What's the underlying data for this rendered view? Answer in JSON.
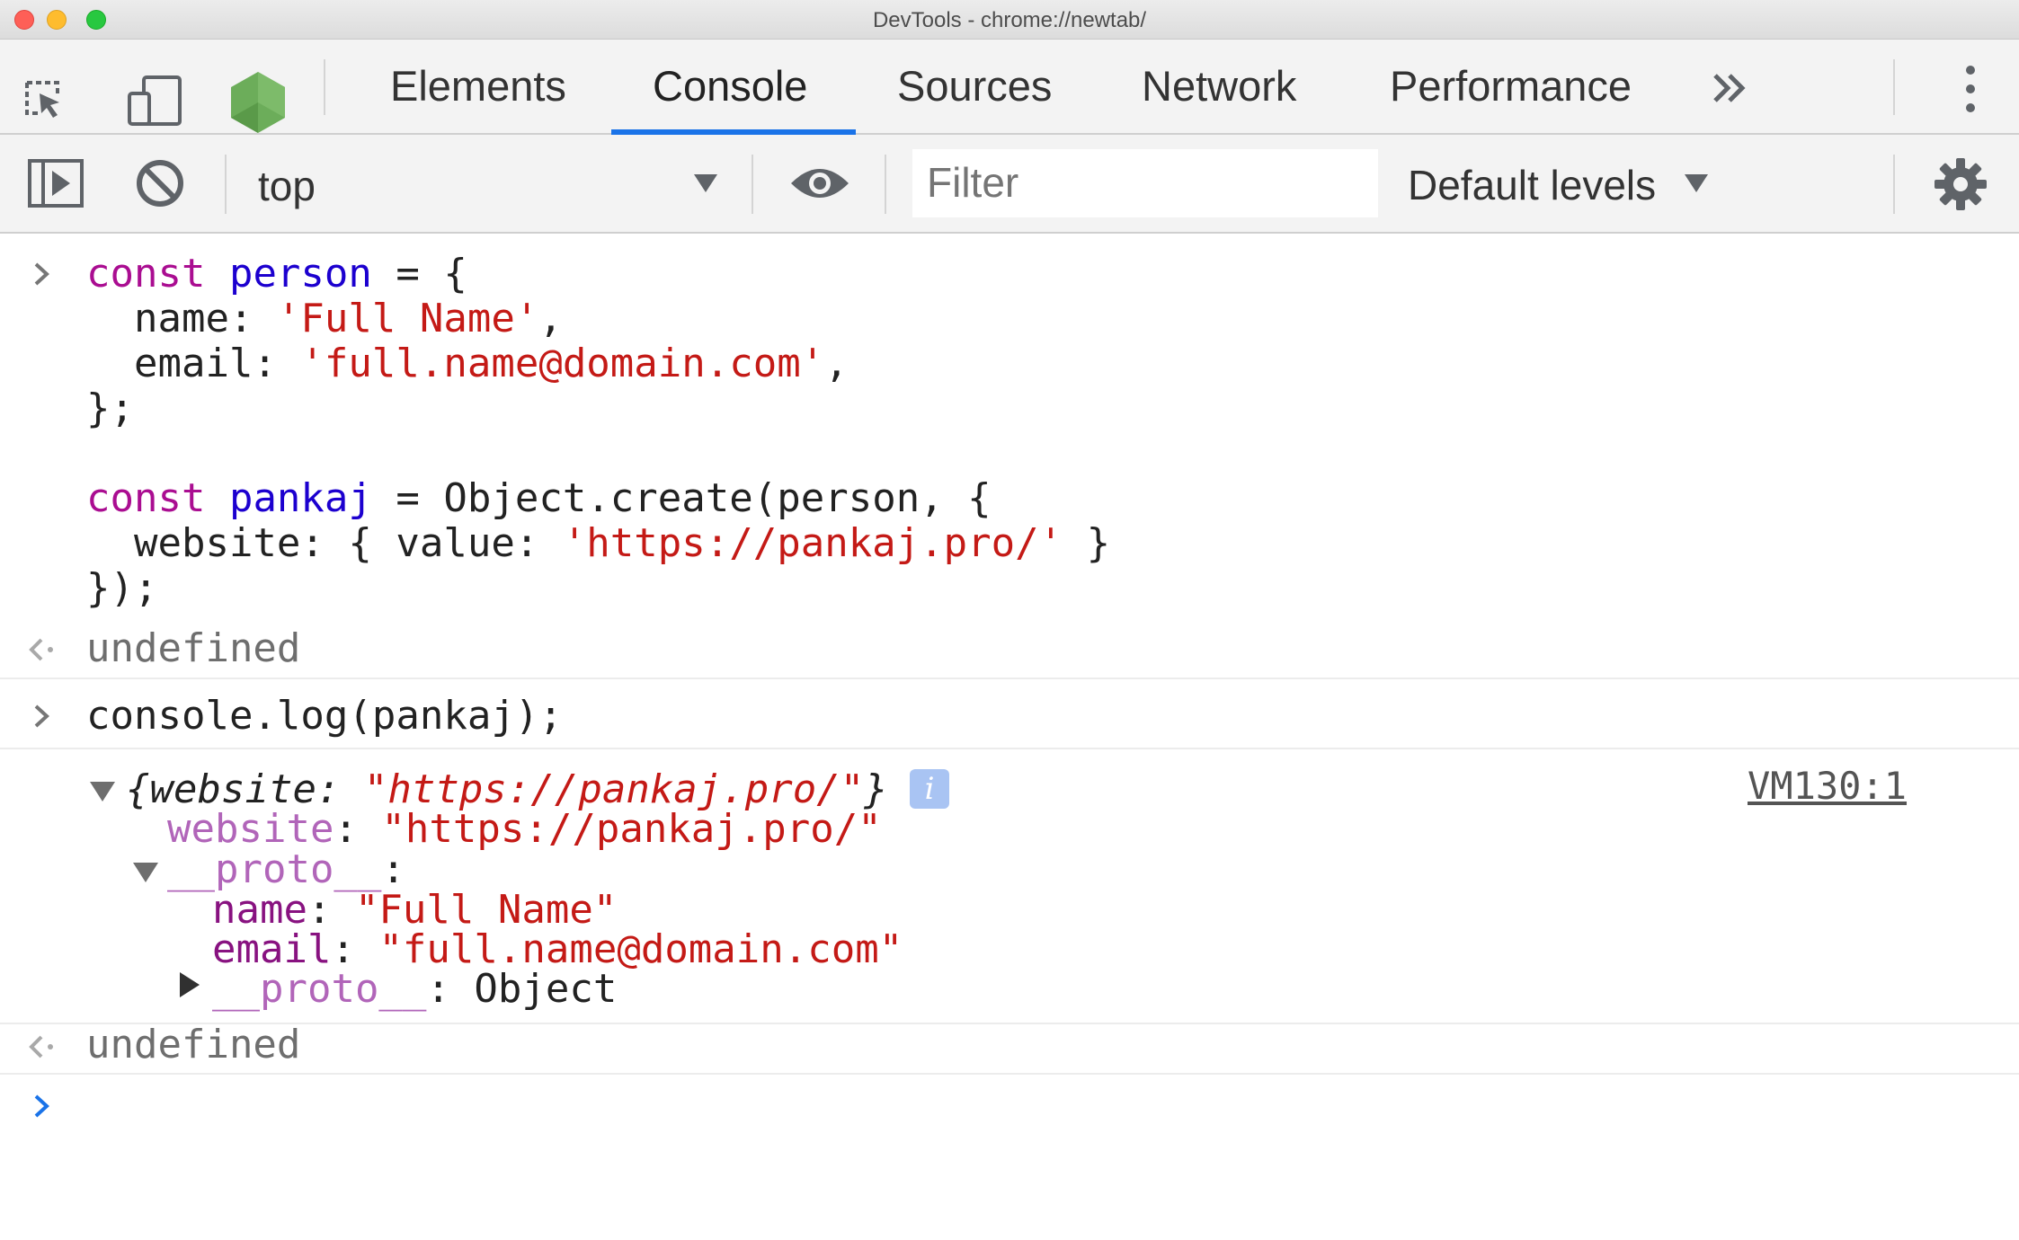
{
  "window": {
    "title": "DevTools - chrome://newtab/"
  },
  "tabs": [
    {
      "label": "Elements",
      "active": false
    },
    {
      "label": "Console",
      "active": true
    },
    {
      "label": "Sources",
      "active": false
    },
    {
      "label": "Network",
      "active": false
    },
    {
      "label": "Performance",
      "active": false
    }
  ],
  "toolbar": {
    "context": "top",
    "filter_placeholder": "Filter",
    "levels_label": "Default levels"
  },
  "console": {
    "input1": {
      "l1_kw": "const",
      "l1_var": "person",
      "l1_rest": " = {",
      "l2_key": "  name: ",
      "l2_val": "'Full Name'",
      "l2_end": ",",
      "l3_key": "  email: ",
      "l3_val": "'full.name@domain.com'",
      "l3_end": ",",
      "l4": "};",
      "l6_kw": "const",
      "l6_var": "pankaj",
      "l6_rest": " = Object.create(person, {",
      "l7_key": "  website: { value: ",
      "l7_val": "'https://pankaj.pro/'",
      "l7_end": " }",
      "l8": "});"
    },
    "result1": "undefined",
    "input2": "console.log(pankaj);",
    "output": {
      "summary_open": "{",
      "summary_key": "website",
      "summary_colon": ": ",
      "summary_val": "\"https://pankaj.pro/\"",
      "summary_close": "}",
      "info": "i",
      "source": "VM130:1",
      "website_key": "website",
      "website_val": "\"https://pankaj.pro/\"",
      "proto_key": "__proto__",
      "name_key": "name",
      "name_val": "\"Full Name\"",
      "email_key": "email",
      "email_val": "\"full.name@domain.com\"",
      "proto2_key": "__proto__",
      "proto2_val": "Object"
    },
    "result2": "undefined"
  },
  "colors": {
    "accent": "#1a73e8",
    "keyword": "#aa0d91",
    "variable": "#1c00cf",
    "string": "#c41a16",
    "property": "#881280"
  }
}
